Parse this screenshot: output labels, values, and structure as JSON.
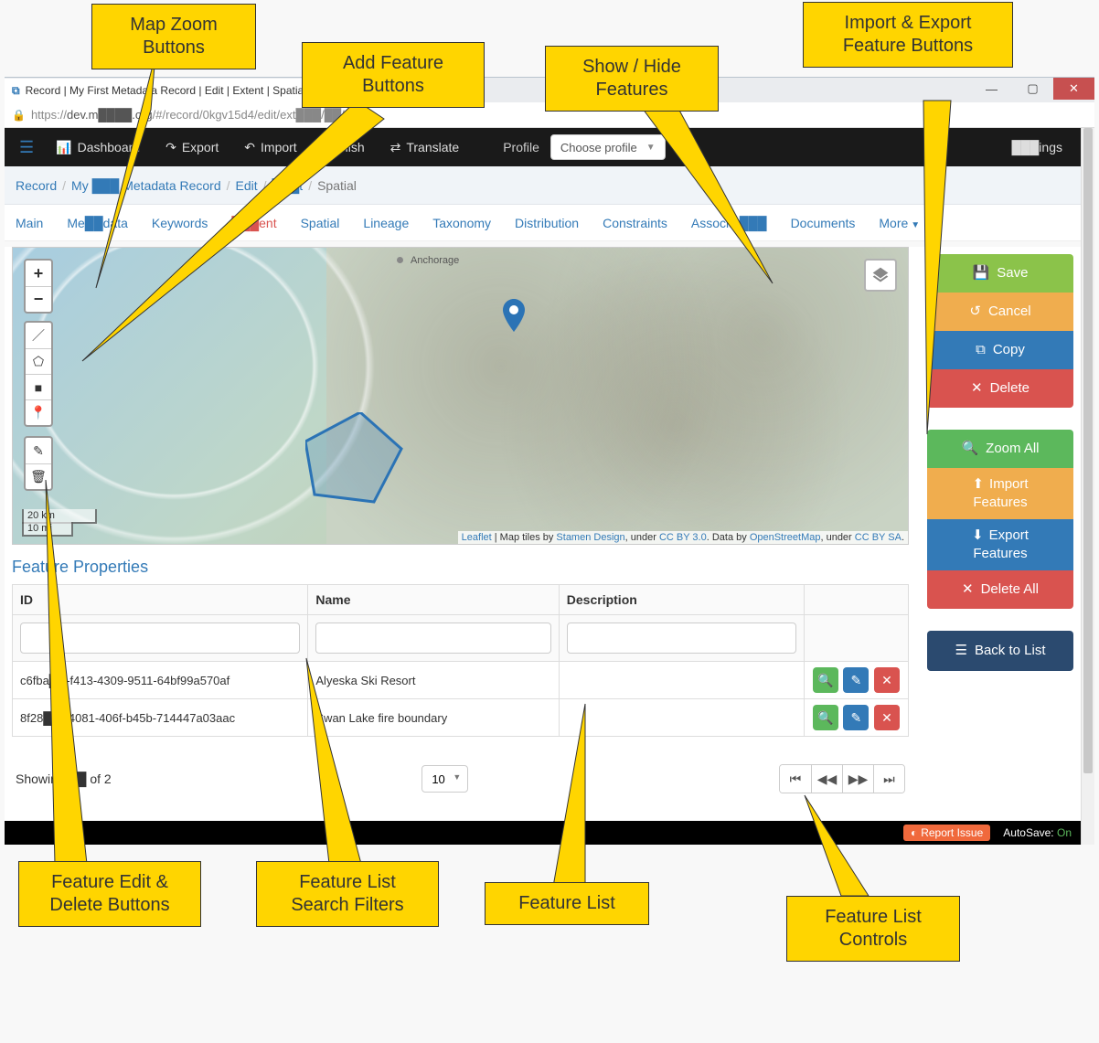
{
  "browser": {
    "tab_title": "Record | My First Metadata Record | Edit | Extent | Spatial",
    "url_scheme": "https://",
    "url_host": "dev.m████.org",
    "url_path": "/#/record/0kgv15d4/edit/ext███/██/0"
  },
  "navbar": {
    "dashboard": "Dashboard",
    "export": "Export",
    "import": "Import",
    "publish": "Publish",
    "translate": "Translate",
    "profile_label": "Profile",
    "profile_select": "Choose profile",
    "settings": "███ings"
  },
  "breadcrumb": {
    "record": "Record",
    "my_record": "My ███ Metadata Record",
    "edit": "Edit",
    "extent": "███t",
    "spatial": "Spatial"
  },
  "tabs": {
    "main": "Main",
    "metadata": "Me██data",
    "keywords": "Keywords",
    "extent": "███ent",
    "spatial": "Spatial",
    "lineage": "Lineage",
    "taxonomy": "Taxonomy",
    "distribution": "Distribution",
    "constraints": "Constraints",
    "associated": "Associat███",
    "documents": "Documents",
    "more": "More"
  },
  "map": {
    "anchorage": "Anchorage",
    "scale_km": "20 km",
    "scale_mi": "10 mi",
    "attrib_leaflet": "Leaflet",
    "attrib_tiles": " | Map tiles by ",
    "attrib_stamen": "Stamen Design",
    "attrib_under1": ", under ",
    "attrib_cc1": "CC BY 3.0",
    "attrib_data": ". Data by ",
    "attrib_osm": "OpenStreetMap",
    "attrib_under2": ", under ",
    "attrib_cc2": "CC BY SA"
  },
  "feature_table": {
    "title": "Feature Properties",
    "col_id": "ID",
    "col_name": "Name",
    "col_desc": "Description",
    "rows": [
      {
        "id": "c6fba██-f413-4309-9511-64bf99a570af",
        "name": "Alyeska Ski Resort",
        "desc": ""
      },
      {
        "id": "8f28███4081-406f-b45b-714447a03aac",
        "name": "Swan Lake fire boundary",
        "desc": ""
      }
    ],
    "showing": "Showing ██ of 2",
    "page_size": "10"
  },
  "side_actions": {
    "save": "Save",
    "cancel": "Cancel",
    "copy": "Copy",
    "delete": "Delete",
    "zoom_all": "Zoom All",
    "import_features": "Import Features",
    "export_features": "Export Features",
    "delete_all": "Delete All",
    "back_to_list": "Back to List"
  },
  "footer": {
    "report": "Report Issue",
    "autosave_label": "AutoSave: ",
    "autosave_state": "On"
  },
  "callouts": {
    "zoom": "Map Zoom Buttons",
    "add_feature": "Add Feature Buttons",
    "show_hide": "Show / Hide Features",
    "import_export": "Import & Export Feature Buttons",
    "edit_delete": "Feature Edit & Delete Buttons",
    "filters": "Feature List Search Filters",
    "feature_list": "Feature List",
    "list_controls": "Feature List Controls"
  }
}
